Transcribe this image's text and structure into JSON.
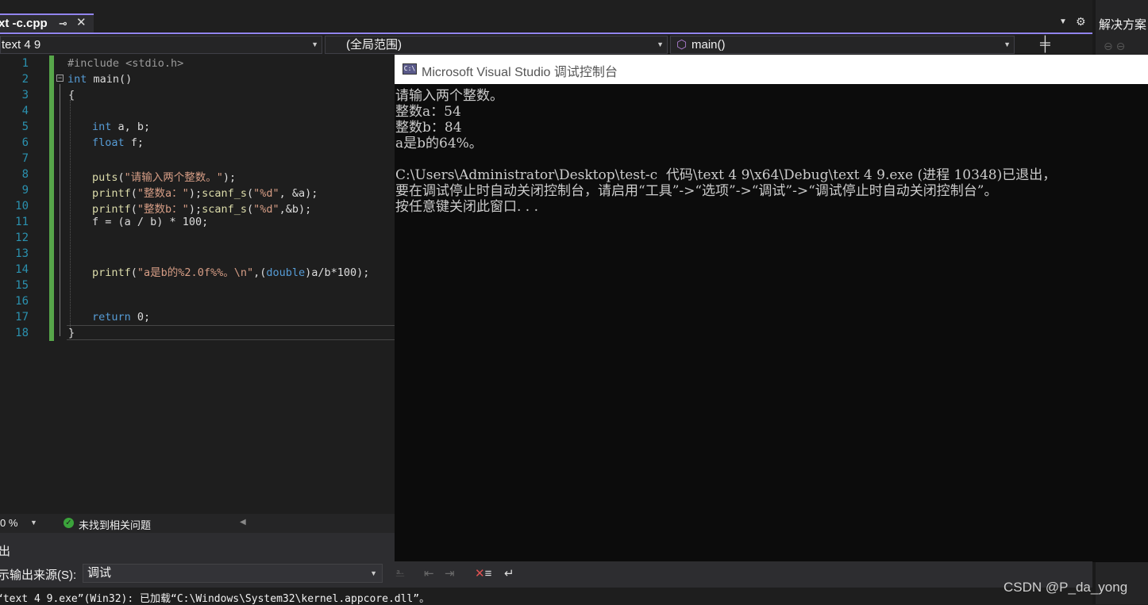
{
  "tab": {
    "file_name": "xt -c.cpp",
    "pin_glyph": "⊸",
    "close_glyph": "✕"
  },
  "navbar": {
    "project": "text 4 9",
    "scope": "(全局范围)",
    "function": "main()"
  },
  "solution_explorer": {
    "title": "解决方案",
    "tools": "⊖ ⊖"
  },
  "editor": {
    "line_numbers": [
      "1",
      "2",
      "3",
      "4",
      "5",
      "6",
      "7",
      "8",
      "9",
      "10",
      "11",
      "12",
      "13",
      "14",
      "15",
      "16",
      "17",
      "18"
    ],
    "code": {
      "l1": "#include <stdio.h>",
      "l2_kw": "int",
      "l2_rest": " main()",
      "l3": "{",
      "l5_kw": "int",
      "l5_rest": " a, b;",
      "l6_kw": "float",
      "l6_rest": " f;",
      "l8_fn": "puts",
      "l8_a": "(",
      "l8_str": "\"请输入两个整数。\"",
      "l8_b": ");",
      "l9_fn": "printf",
      "l9_a": "(",
      "l9_str": "\"整数a：\"",
      "l9_b": ");",
      "l9_fn2": "scanf_s",
      "l9_c": "(",
      "l9_str2": "\"%d\"",
      "l9_d": ", &a);",
      "l10_fn": "printf",
      "l10_a": "(",
      "l10_str": "\"整数b：\"",
      "l10_b": ");",
      "l10_fn2": "scanf_s",
      "l10_c": "(",
      "l10_str2": "\"%d\"",
      "l10_d": ",&b);",
      "l11": "f = (a / b) * 100;",
      "l14_fn": "printf",
      "l14_a": "(",
      "l14_str": "\"a是b的%2.0f%%。\\n\"",
      "l14_b": ",(",
      "l14_kw": "double",
      "l14_c": ")a/b*100);",
      "l17_kw": "return",
      "l17_rest": " 0;",
      "l18": "}"
    }
  },
  "editor_status": {
    "zoom": "0 %",
    "issues": "未找到相关问题"
  },
  "console": {
    "title": "Microsoft Visual Studio 调试控制台",
    "icon_text": "C:\\",
    "lines": [
      "请输入两个整数。",
      "整数a：54",
      "整数b：84",
      "a是b的64%。",
      "",
      "C:\\Users\\Administrator\\Desktop\\test-c  代码\\text 4 9\\x64\\Debug\\text 4 9.exe (进程 10348)已退出，",
      "要在调试停止时自动关闭控制台，请启用“工具”->“选项”->“调试”->“调试停止时自动关闭控制台”。",
      "按任意键关闭此窗口. . ."
    ]
  },
  "output": {
    "title": "出",
    "source_label": "示输出来源(S):",
    "source_value": "调试",
    "log_line": "“text 4 9.exe”(Win32): 已加载“C:\\Windows\\System32\\kernel.appcore.dll”。"
  },
  "watermark": "CSDN @P_da_yong"
}
